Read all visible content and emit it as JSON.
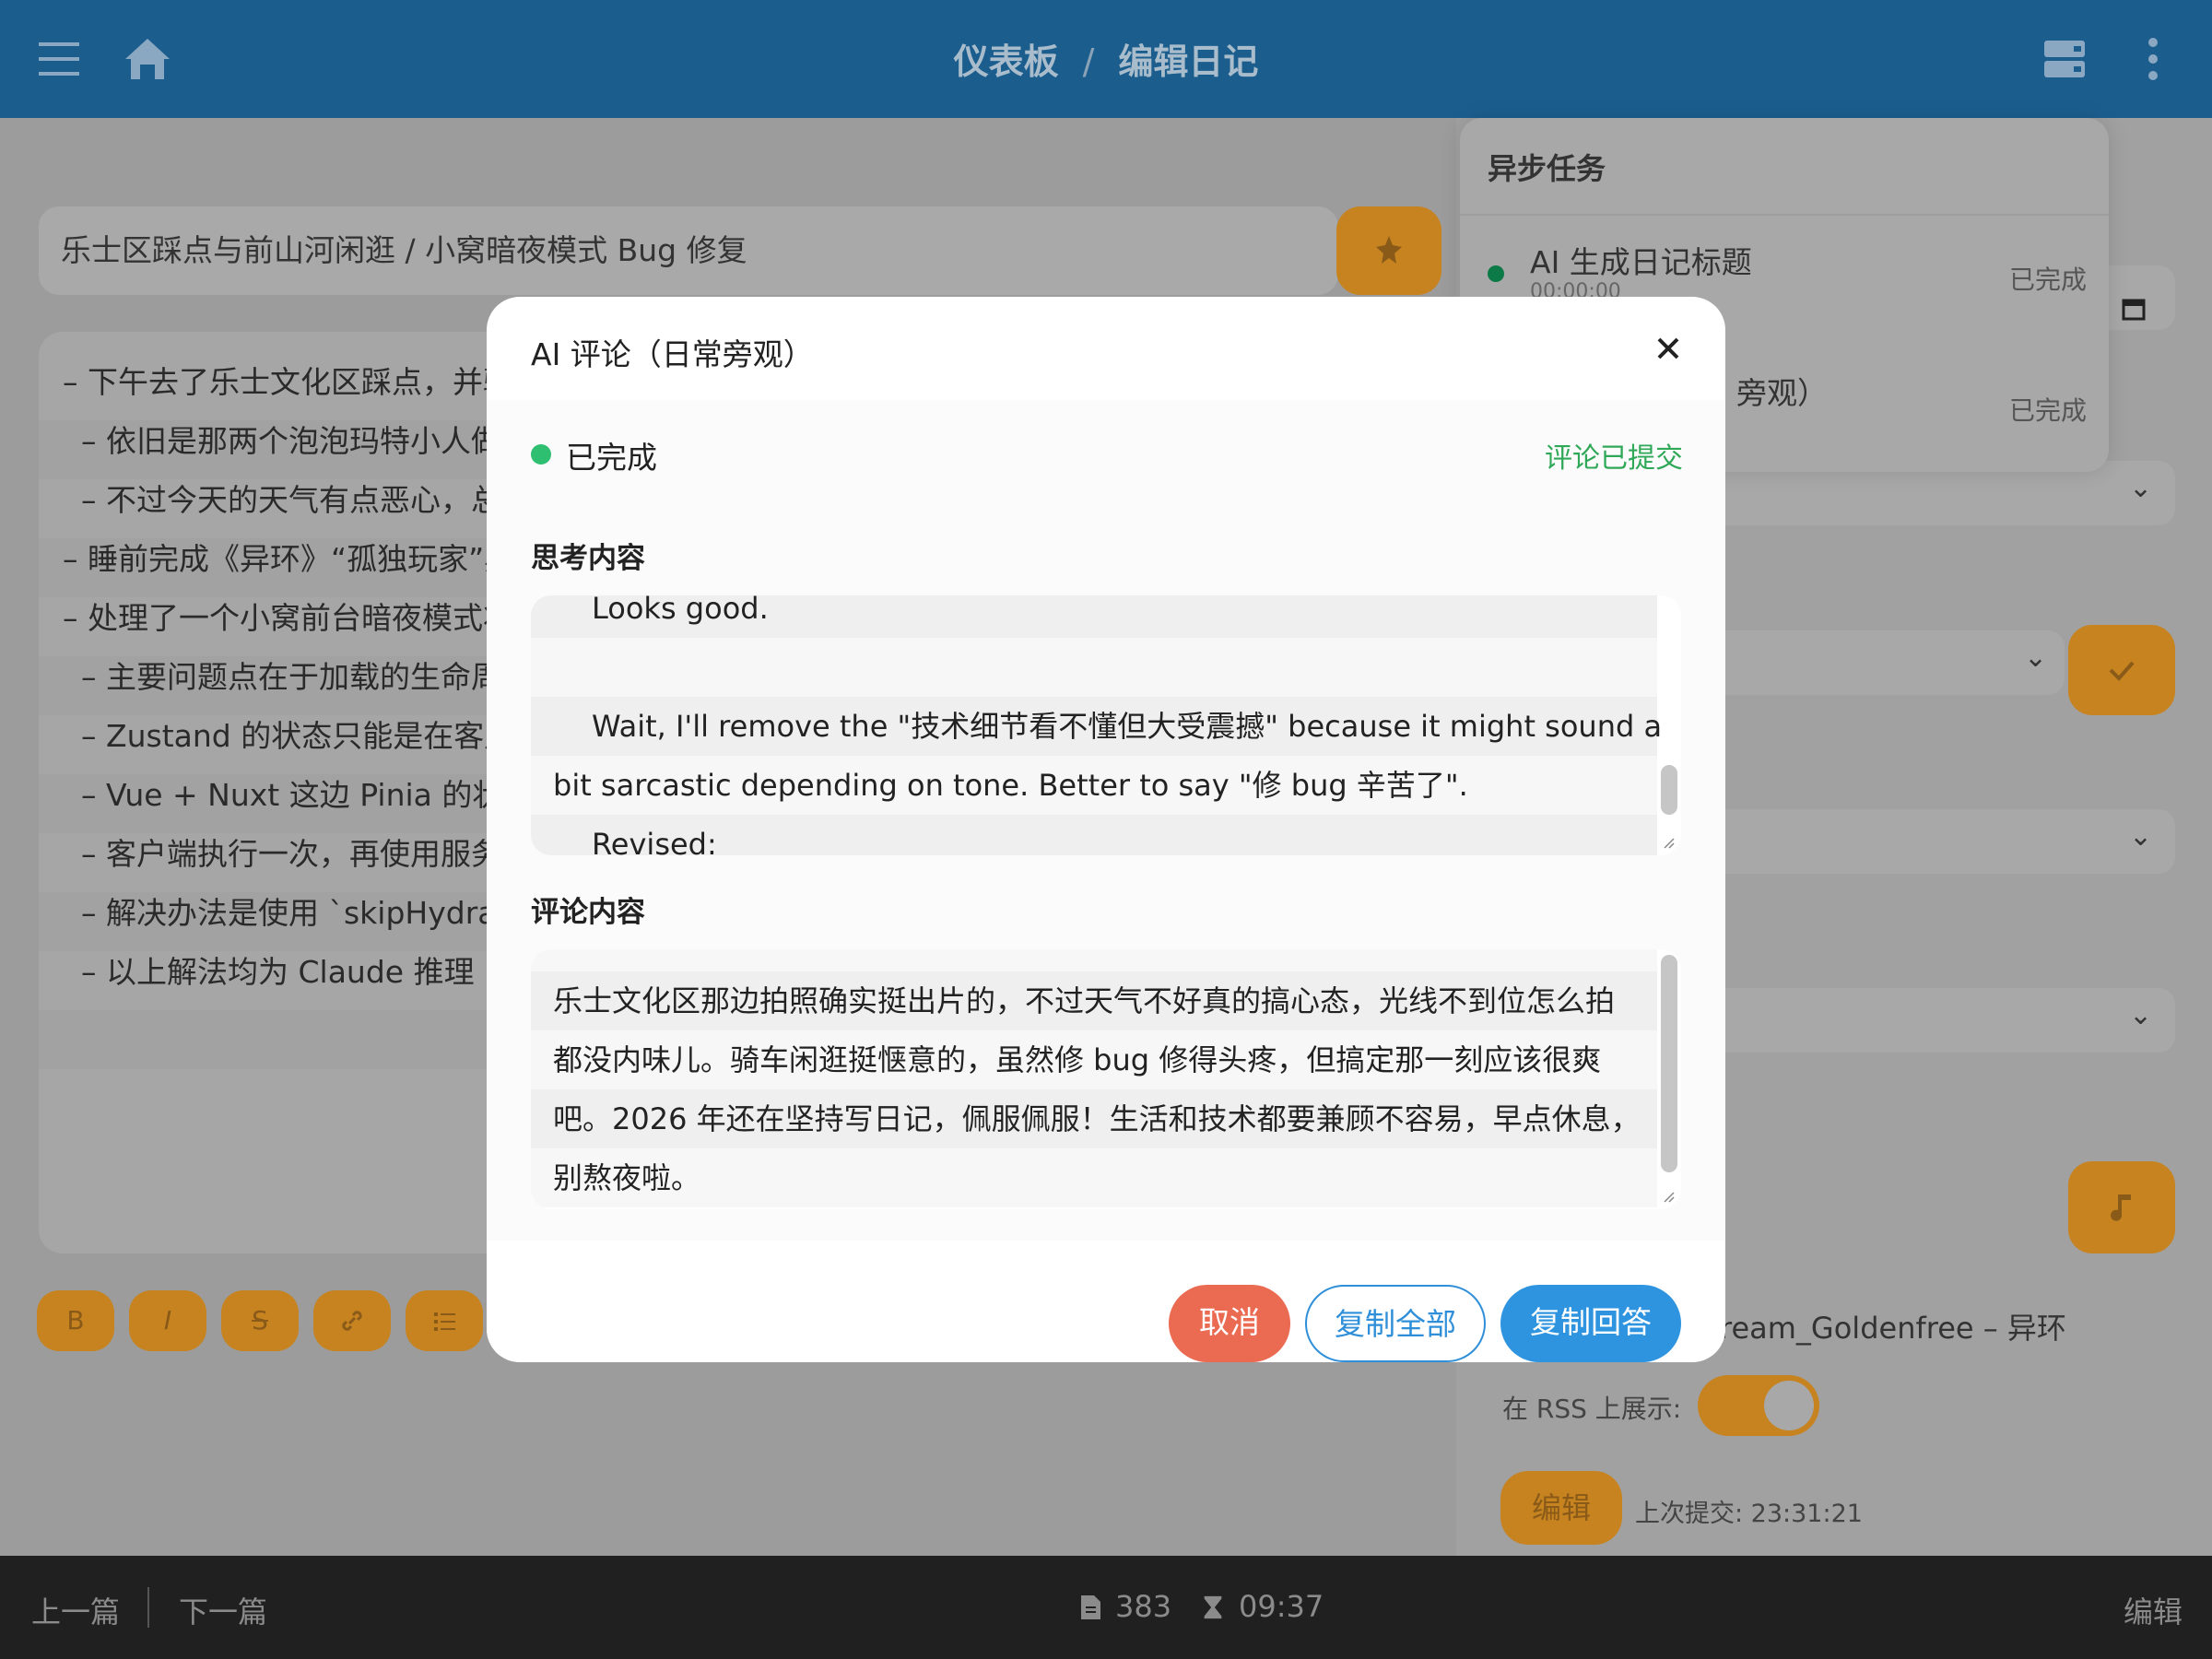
{
  "topbar": {
    "breadcrumb": [
      "仪表板",
      "编辑日记"
    ],
    "separator": "/",
    "icons": [
      "menu-icon",
      "home-icon",
      "layout-icon",
      "more-vertical-icon"
    ]
  },
  "editor": {
    "title": "乐士区踩点与前山河闲逛 / 小窝暗夜模式 Bug 修复",
    "lines": [
      "– 下午去了乐士文化区踩点，并骑",
      "– 依旧是那两个泡泡玛特小人做",
      "– 不过今天的天气有点恶心，总",
      "– 睡前完成《异环》“孤独玩家”异",
      "– 处理了一个小窝前台暗夜模式状",
      "– 主要问题点在于加载的生命周",
      "– Zustand 的状态只能是在客户",
      "– Vue + Nuxt 这边 Pinia 的状态",
      "– 客户端执行一次，再使用服务",
      "– 解决办法是使用 `skipHydrate",
      "– 以上解法均为 Claude 推理"
    ],
    "format_buttons": [
      "B",
      "I",
      "S",
      "link",
      "list"
    ]
  },
  "async_tasks": {
    "header": "异步任务",
    "items": [
      {
        "name": "AI 生成日记标题",
        "time": "00:00:00",
        "status": "已完成"
      },
      {
        "name": "旁观）",
        "status": "已完成"
      }
    ]
  },
  "side": {
    "music_text": "ream_Goldenfree – 异环",
    "rss_label": "在 RSS 上展示:",
    "rss_enabled": true,
    "edit_button": "编辑",
    "last_submit": "上次提交: 23:31:21"
  },
  "modal": {
    "title": "AI 评论（日常旁观）",
    "status": "已完成",
    "status_right": "评论已提交",
    "thinking_label": "思考内容",
    "thinking_lines": [
      "Looks good.",
      "",
      "Wait, I'll remove the \"技术细节看不懂但大受震撼\" because it might sound a",
      "bit sarcastic depending on tone. Better to say \"修 bug 辛苦了\".",
      "Revised:"
    ],
    "comment_label": "评论内容",
    "comment_lines": [
      "乐士文化区那边拍照确实挺出片的，不过天气不好真的搞心态，光线不到位怎么拍",
      "都没内味儿。骑车闲逛挺惬意的，虽然修 bug 修得头疼，但搞定那一刻应该很爽",
      "吧。2026 年还在坚持写日记，佩服佩服！生活和技术都要兼顾不容易，早点休息，",
      "别熬夜啦。"
    ],
    "buttons": {
      "cancel": "取消",
      "copy_all": "复制全部",
      "copy_answer": "复制回答"
    }
  },
  "bottombar": {
    "prev": "上一篇",
    "next": "下一篇",
    "word_count": "383",
    "read_time": "09:37",
    "edit": "编辑"
  },
  "colors": {
    "topbar": "#1b5e8e",
    "accent_orange": "#f0a030",
    "success_green": "#2fbf71",
    "primary_blue": "#2f94e0",
    "danger_red": "#ea6a52"
  }
}
